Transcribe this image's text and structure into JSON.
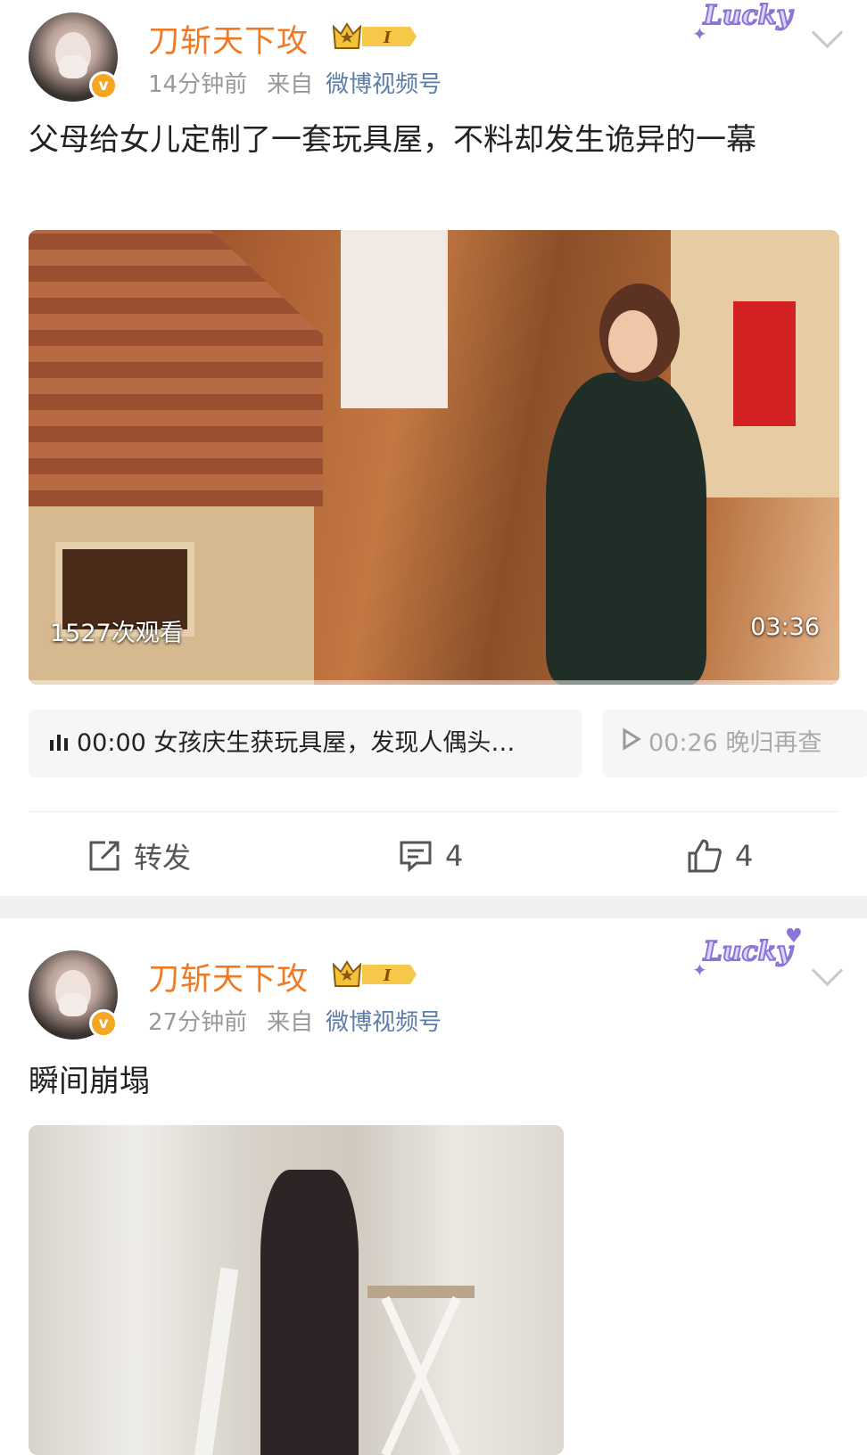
{
  "posts": [
    {
      "username": "刀斩天下攻",
      "level_badge": "I",
      "time": "14分钟前",
      "from_label": "来自",
      "source": "微博视频号",
      "decoration": "Lucky",
      "text": "父母给女儿定制了一套玩具屋，不料却发生诡异的一幕",
      "video": {
        "views": "1527次观看",
        "duration": "03:36"
      },
      "chapters": [
        {
          "icon": "audio-bars-icon",
          "label": "00:00 女孩庆生获玩具屋，发现人偶头…"
        },
        {
          "icon": "play-icon",
          "label": "00:26 晚归再查"
        }
      ],
      "actions": {
        "repost_label": "转发",
        "comment_count": "4",
        "like_count": "4"
      }
    },
    {
      "username": "刀斩天下攻",
      "level_badge": "I",
      "time": "27分钟前",
      "from_label": "来自",
      "source": "微博视频号",
      "decoration": "Lucky",
      "text": "瞬间崩塌"
    }
  ],
  "colors": {
    "username": "#f07a24",
    "source_link": "#5b7da8",
    "meta": "#999999",
    "verified_badge": "#f5a623",
    "lucky": "#8a74d6",
    "separator": "#efefef"
  }
}
